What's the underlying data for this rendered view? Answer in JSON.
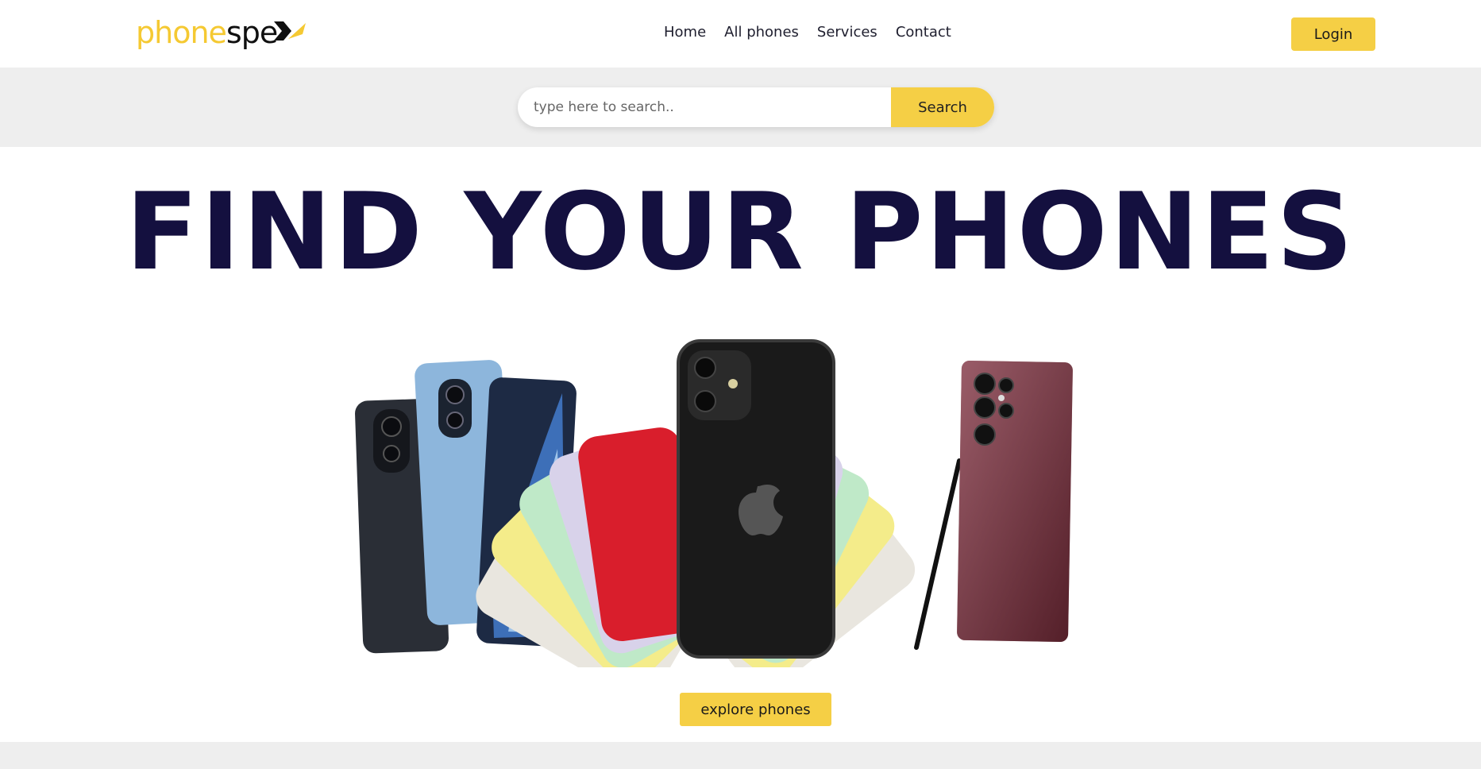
{
  "header": {
    "logo": {
      "part1": "phone",
      "part2": "spe",
      "brand_color": "#f5c932"
    },
    "nav": [
      {
        "label": "Home"
      },
      {
        "label": "All phones"
      },
      {
        "label": "Services"
      },
      {
        "label": "Contact"
      }
    ],
    "login_label": "Login"
  },
  "search": {
    "placeholder": "type here to search..",
    "value": "",
    "button_label": "Search"
  },
  "hero": {
    "title": "FIND YOUR PHONES",
    "image_icon": "phones-collage-image",
    "explore_label": "explore phones"
  },
  "colors": {
    "accent": "#f5cf45",
    "title": "#14103f",
    "band": "#eeeeee"
  }
}
